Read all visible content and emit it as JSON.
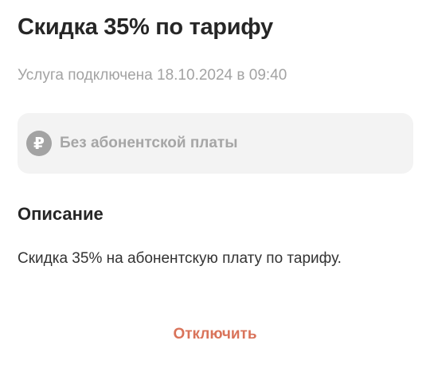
{
  "header": {
    "title": "Скидка 35% по тарифу",
    "subtitle": "Услуга подключена 18.10.2024 в 09:40"
  },
  "fee_card": {
    "icon": "ruble-icon",
    "icon_glyph": "₽",
    "label": "Без абонентской платы"
  },
  "description": {
    "heading": "Описание",
    "text": "Скидка 35% на абонентскую плату по тарифу."
  },
  "actions": {
    "disable_label": "Отключить"
  },
  "colors": {
    "accent": "#d9735a",
    "muted": "#a3a3a3",
    "card_background": "#f3f3f3"
  }
}
